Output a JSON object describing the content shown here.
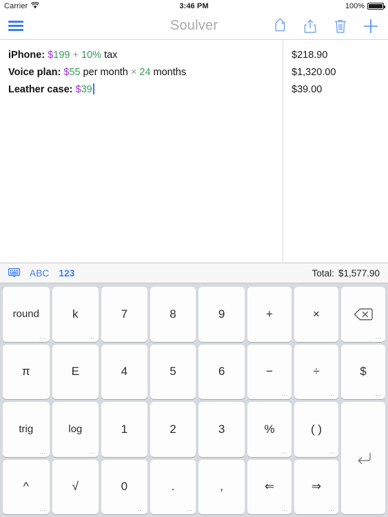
{
  "status_bar": {
    "carrier": "Carrier",
    "wifi_icon": "wifi-icon",
    "time": "3:46 PM",
    "battery_percent": "100%",
    "battery_icon": "battery-full-icon"
  },
  "nav_bar": {
    "menu_icon": "hamburger-menu-icon",
    "title": "Soulver",
    "actions": [
      {
        "name": "tag-icon",
        "label": "Tag"
      },
      {
        "name": "share-icon",
        "label": "Share"
      },
      {
        "name": "trash-icon",
        "label": "Delete"
      },
      {
        "name": "plus-icon",
        "label": "New"
      }
    ]
  },
  "editor": {
    "lines": [
      {
        "label": "iPhone:",
        "tokens": [
          {
            "t": "$",
            "k": "cur"
          },
          {
            "t": "199",
            "k": "num"
          },
          {
            "t": " + ",
            "k": "op"
          },
          {
            "t": "10",
            "k": "num"
          },
          {
            "t": "%",
            "k": "num"
          },
          {
            "t": " tax",
            "k": "txt"
          }
        ],
        "result": "$218.90"
      },
      {
        "label": "Voice plan:",
        "tokens": [
          {
            "t": "$",
            "k": "cur"
          },
          {
            "t": "55",
            "k": "num"
          },
          {
            "t": " per month ",
            "k": "txt"
          },
          {
            "t": "×",
            "k": "op"
          },
          {
            "t": " 24",
            "k": "num"
          },
          {
            "t": " months",
            "k": "txt"
          }
        ],
        "result": "$1,320.00"
      },
      {
        "label": "Leather case:",
        "tokens": [
          {
            "t": "$",
            "k": "cur"
          },
          {
            "t": "39",
            "k": "num"
          }
        ],
        "result": "$39.00",
        "caret": true
      }
    ]
  },
  "keyboard_bar": {
    "keyboard_icon": "keyboard-icon",
    "mode_abc": "ABC",
    "mode_123": "123",
    "selected_mode": "123",
    "total_label": "Total:",
    "total_value": "$1,577.90"
  },
  "keyboard": {
    "functions": [
      {
        "label": "round",
        "more": true,
        "name": "key-round"
      },
      {
        "label": "k",
        "more": true,
        "name": "key-k"
      },
      {
        "label": "π",
        "more": false,
        "name": "key-pi"
      },
      {
        "label": "E",
        "more": false,
        "name": "key-e"
      },
      {
        "label": "trig",
        "more": true,
        "name": "key-trig"
      },
      {
        "label": "log",
        "more": true,
        "name": "key-log"
      },
      {
        "label": "^",
        "more": true,
        "name": "key-caret"
      },
      {
        "label": "√",
        "more": false,
        "name": "key-sqrt"
      }
    ],
    "numbers": [
      {
        "label": "7",
        "more": false,
        "name": "key-7"
      },
      {
        "label": "8",
        "more": false,
        "name": "key-8"
      },
      {
        "label": "9",
        "more": false,
        "name": "key-9"
      },
      {
        "label": "4",
        "more": false,
        "name": "key-4"
      },
      {
        "label": "5",
        "more": false,
        "name": "key-5"
      },
      {
        "label": "6",
        "more": false,
        "name": "key-6"
      },
      {
        "label": "1",
        "more": false,
        "name": "key-1"
      },
      {
        "label": "2",
        "more": false,
        "name": "key-2"
      },
      {
        "label": "3",
        "more": false,
        "name": "key-3"
      },
      {
        "label": "0",
        "more": true,
        "name": "key-0"
      },
      {
        "label": ".",
        "more": true,
        "name": "key-decimal"
      },
      {
        "label": ",",
        "more": false,
        "name": "key-comma"
      }
    ],
    "operators": [
      {
        "label": "+",
        "more": false,
        "name": "key-plus"
      },
      {
        "label": "×",
        "more": false,
        "name": "key-multiply"
      },
      {
        "label": "",
        "more": true,
        "name": "key-backspace",
        "icon": "backspace-icon"
      },
      {
        "label": "−",
        "more": true,
        "name": "key-minus"
      },
      {
        "label": "÷",
        "more": true,
        "name": "key-divide"
      },
      {
        "label": "$",
        "more": true,
        "name": "key-dollar"
      },
      {
        "label": "%",
        "more": true,
        "name": "key-percent"
      },
      {
        "label": "( )",
        "more": true,
        "name": "key-parentheses"
      },
      {
        "label": "",
        "more": false,
        "name": "key-return",
        "icon": "return-icon",
        "tall": true
      },
      {
        "label": "⇐",
        "more": true,
        "name": "key-arrow-left"
      },
      {
        "label": "⇒",
        "more": true,
        "name": "key-arrow-right"
      }
    ]
  },
  "colors": {
    "accent_blue": "#3b7df5",
    "currency_purple": "#9b30d9",
    "number_green": "#2f9e57",
    "operator_gray": "#8d8d8d",
    "keyboard_bg": "#d6dade"
  }
}
